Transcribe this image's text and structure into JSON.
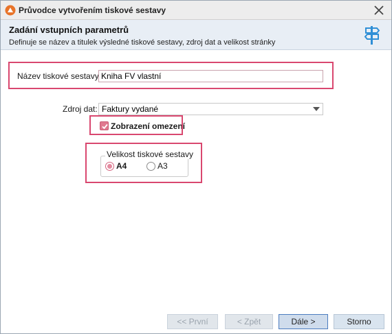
{
  "window": {
    "title": "Průvodce vytvořením tiskové sestavy"
  },
  "header": {
    "title": "Zadání vstupních parametrů",
    "description": "Definuje se název a titulek výsledné tiskové sestavy, zdroj dat a velikost stránky"
  },
  "form": {
    "name_label": "Název tiskové sestavy:",
    "name_value": "Kniha FV vlastní",
    "source_label": "Zdroj dat:",
    "source_value": "Faktury vydané",
    "restriction_label": "Zobrazení omezení",
    "restriction_checked": true,
    "size_group_title": "Velikost tiskové sestavy",
    "size_options": [
      {
        "label": "A4",
        "selected": true
      },
      {
        "label": "A3",
        "selected": false
      }
    ]
  },
  "buttons": {
    "first": {
      "label": "<< První",
      "enabled": false
    },
    "back": {
      "label": "< Zpět",
      "enabled": false
    },
    "next": {
      "label": "Dále >",
      "enabled": true
    },
    "cancel": {
      "label": "Storno",
      "enabled": true
    }
  },
  "colors": {
    "highlight": "#d9476f",
    "checkbox_fill": "#e07a90",
    "header_bg": "#e8eef5",
    "accent_icon": "#2f8fd6"
  },
  "icons": {
    "app": "app-logo-icon",
    "close": "close-icon",
    "header": "signpost-icon",
    "combo": "chevron-down-icon",
    "check": "check-icon"
  }
}
